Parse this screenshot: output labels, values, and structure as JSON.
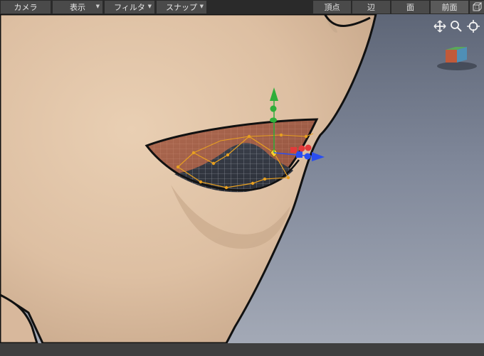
{
  "toolbar": {
    "menus": [
      {
        "label": "カメラ"
      },
      {
        "label": "表示"
      },
      {
        "label": "フィルタ"
      },
      {
        "label": "スナップ"
      }
    ],
    "component_tabs": [
      {
        "label": "頂点"
      },
      {
        "label": "辺"
      },
      {
        "label": "面"
      },
      {
        "label": "前面"
      }
    ],
    "dropdown_icon": "chevron-down-icon",
    "wireframe_toggle_icon": "wireframe-cube-icon"
  },
  "viewport": {
    "nav_icons": [
      "move-pan-icon",
      "zoom-magnifier-icon",
      "frame-target-icon"
    ],
    "view_cube_icon": "view-cube-icon",
    "colors": {
      "skin": "#e0c2a5",
      "eye_surface": "#a8624a",
      "control_curve": "#e8a020",
      "gizmo_y": "#2fae3a",
      "gizmo_x": "#e33a3a",
      "gizmo_z": "#2a4ef0"
    }
  }
}
